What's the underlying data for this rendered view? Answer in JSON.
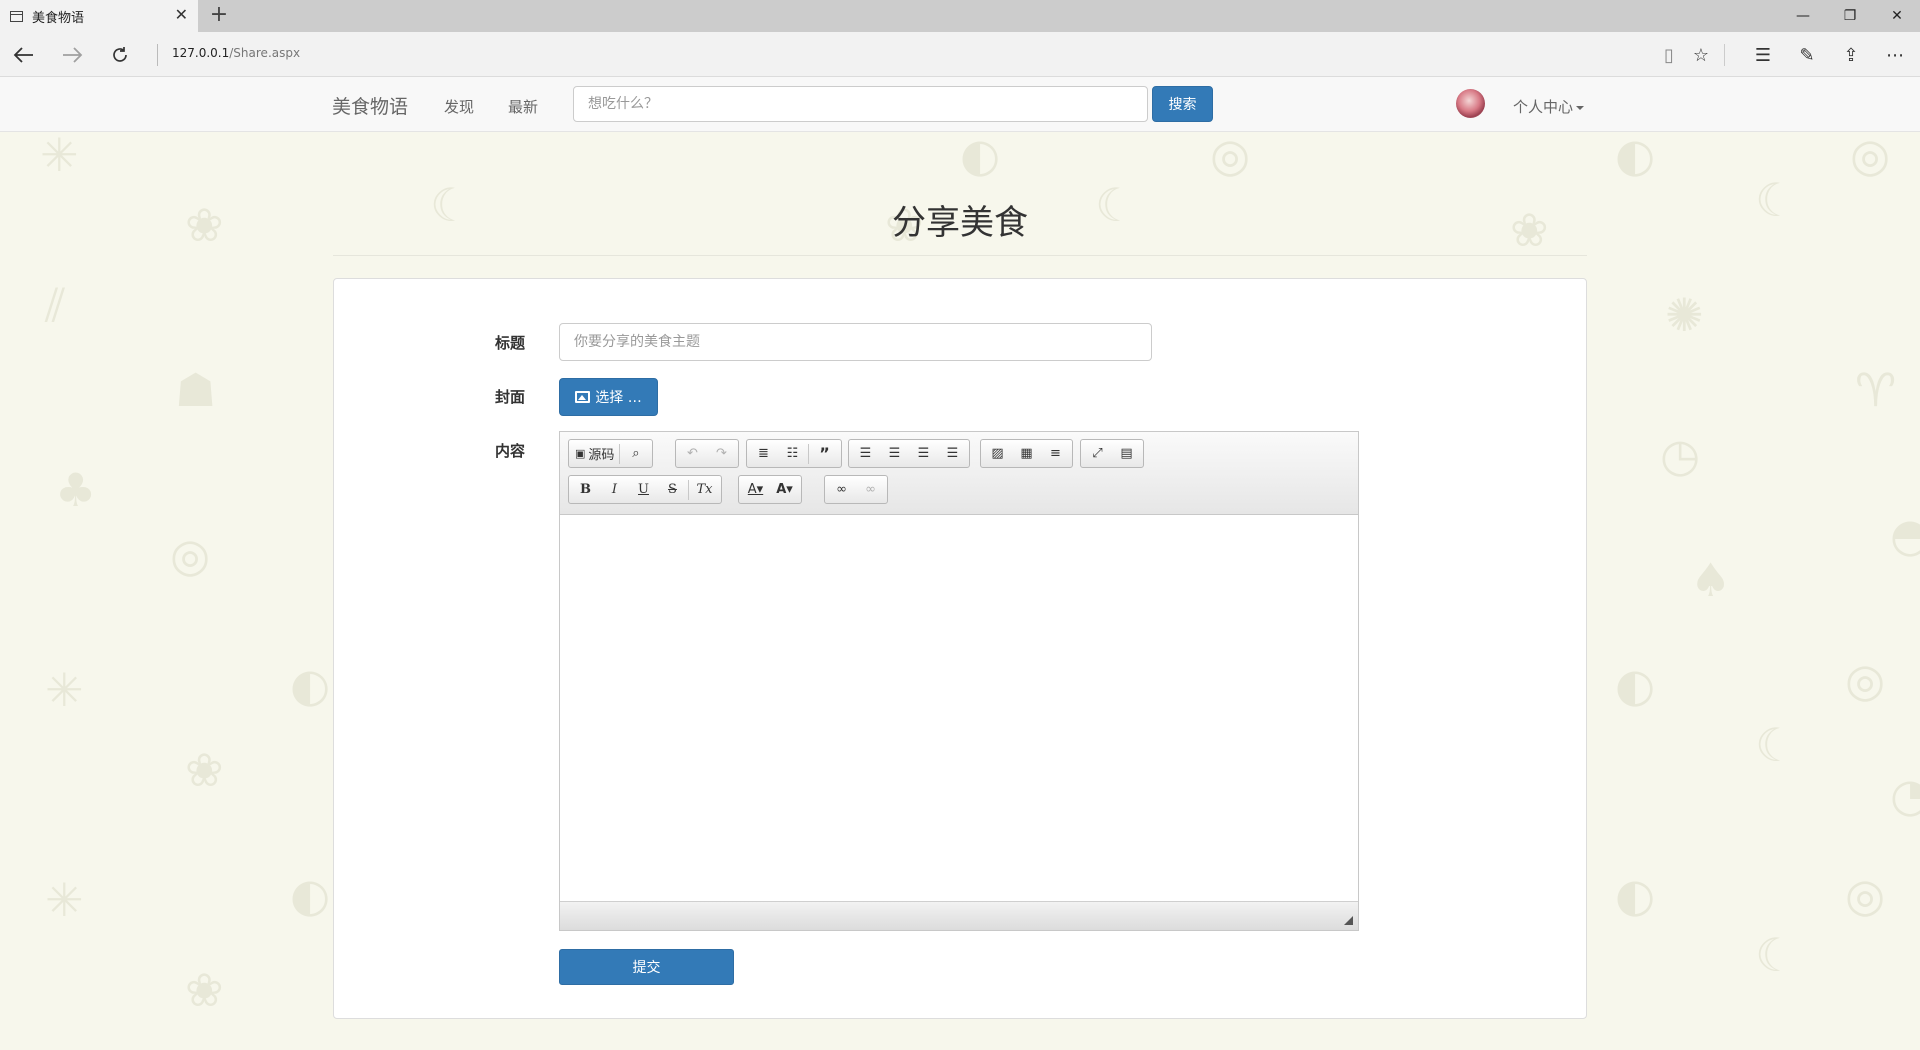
{
  "browser": {
    "tab_title": "美食物语",
    "tab_close": "✕",
    "new_tab": "+",
    "url_host": "127.0.0.1",
    "url_path": "/Share.aspx",
    "window_controls": {
      "minimize": "—",
      "restore": "❐",
      "close": "✕"
    },
    "toolbar_icons": {
      "reading_view": "▯",
      "favorite": "☆",
      "hub": "☰",
      "web_note": "✎",
      "share": "⇪",
      "more": "⋯"
    }
  },
  "site_nav": {
    "brand": "美食物语",
    "links": [
      "发现",
      "最新"
    ],
    "search_placeholder": "想吃什么？",
    "search_button": "搜索",
    "user_menu": "个人中心"
  },
  "page": {
    "title": "分享美食",
    "form": {
      "title_label": "标题",
      "title_placeholder": "你要分享的美食主题",
      "cover_label": "封面",
      "cover_button": "选择 …",
      "content_label": "内容",
      "submit_button": "提交"
    }
  },
  "editor_toolbar": {
    "source": "源码",
    "buttons_row1": [
      "preview",
      "undo",
      "redo",
      "numbered-list",
      "bulleted-list",
      "blockquote",
      "align-left",
      "align-center",
      "align-right",
      "justify",
      "image",
      "table",
      "horizontal-rule",
      "maximize",
      "show-blocks"
    ],
    "buttons_row2": [
      "bold",
      "italic",
      "underline",
      "strikethrough",
      "remove-format",
      "text-color",
      "background-color",
      "link",
      "unlink"
    ],
    "labels": {
      "bold": "B",
      "italic": "I",
      "underline": "U",
      "strike": "S",
      "remove_format": "Tx",
      "text_color": "A▾",
      "bg_color": "A▾"
    }
  },
  "colors": {
    "primary": "#337ab7",
    "background": "#f7f7ec"
  }
}
